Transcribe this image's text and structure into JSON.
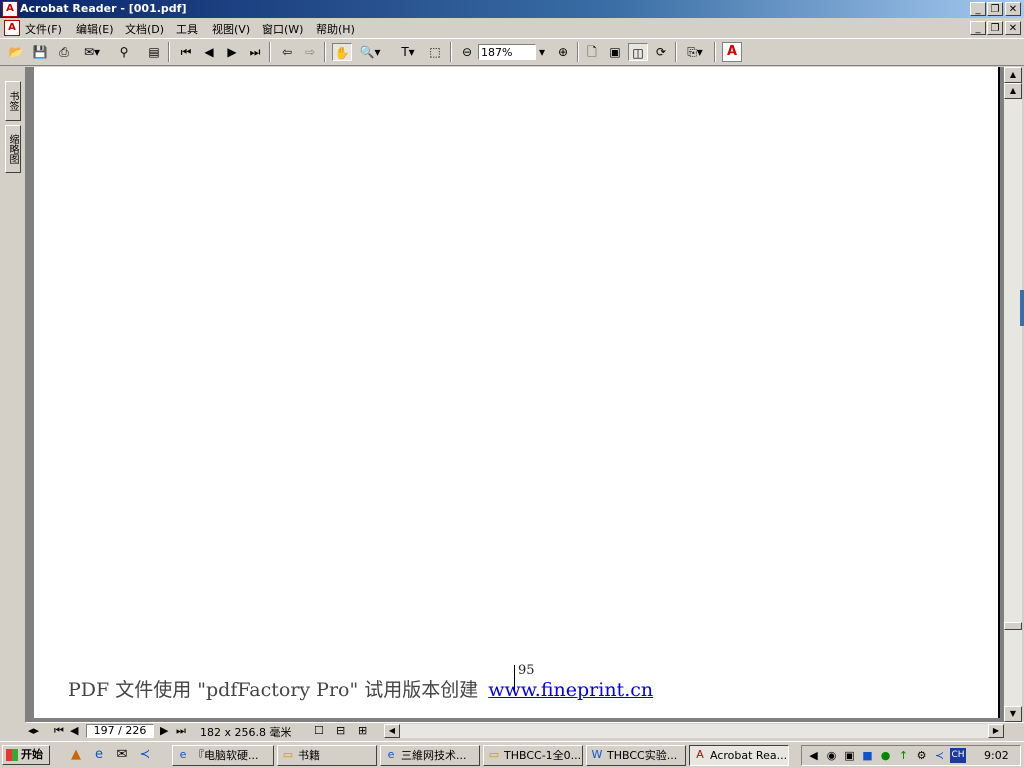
{
  "window": {
    "title": "Acrobat Reader - [001.pdf]",
    "app_icon": "pdf-icon",
    "controls": [
      "_",
      "❐",
      "✕"
    ]
  },
  "menu": {
    "items": [
      "文件(F)",
      "编辑(E)",
      "文档(D)",
      "工具",
      "视图(V)",
      "窗口(W)",
      "帮助(H)"
    ]
  },
  "toolbar": {
    "zoom_value": "187%",
    "zoom_out": "⊖",
    "zoom_in": "⊕",
    "icons": [
      "open-icon",
      "save-icon",
      "print-icon",
      "email-icon",
      "search-icon",
      "show-navigation-icon",
      "first-page-icon",
      "previous-page-icon",
      "next-page-icon",
      "last-page-icon",
      "go-back-icon",
      "go-forward-icon",
      "hand-tool-icon",
      "zoom-tool-icon",
      "text-select-icon",
      "graphics-select-icon",
      "actual-size-icon",
      "fit-page-icon",
      "fit-width-icon",
      "rotate-icon",
      "review-icon",
      "adobe-logo"
    ]
  },
  "navigation_tabs": [
    "书签",
    "缩略图"
  ],
  "document": {
    "page_number": "95",
    "watermark_text": "PDF 文件使用 \"pdfFactory Pro\" 试用版本创建",
    "watermark_link": "www.fineprint.cn"
  },
  "status": {
    "current_page": "197 / 226",
    "page_size": "182 x 256.8 毫米"
  },
  "taskbar": {
    "start_label": "开始",
    "tasks": [
      {
        "label": "『电脑软硬...",
        "icon": "ie-icon"
      },
      {
        "label": "书籍",
        "icon": "folder-icon"
      },
      {
        "label": "三維网技术...",
        "icon": "ie-icon"
      },
      {
        "label": "THBCC-1全0...",
        "icon": "folder-icon"
      },
      {
        "label": "THBCC实验...",
        "icon": "word-icon"
      },
      {
        "label": "Acrobat Rea...",
        "icon": "acrobat-icon"
      }
    ],
    "tray_lang": "CH",
    "clock": "9:02"
  }
}
